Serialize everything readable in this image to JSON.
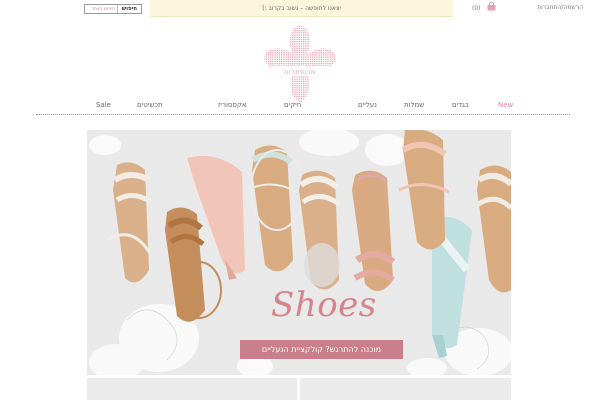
{
  "topbar": {
    "account_links": "הרשמה/התחברות",
    "cart_count": "(0)",
    "promo_text": "יצאנו לחופשה – נשוב בקרוב :)",
    "search_button": "חיפוש",
    "search_placeholder": "חיפוש באתר"
  },
  "logo": {
    "text": "מכופתרות",
    "color": "#e8a3b4"
  },
  "nav": {
    "items": [
      {
        "label": "New"
      },
      {
        "label": "בגדים"
      },
      {
        "label": "שמלות"
      },
      {
        "label": "נעליים"
      },
      {
        "label": "חיקים"
      },
      {
        "label": "אקססוריז"
      },
      {
        "label": "תכשיטים"
      },
      {
        "label": "Sale"
      }
    ],
    "active_color": "#e4839f"
  },
  "hero": {
    "title": "Shoes",
    "badge": "מוכנה להתרגש? קולקציית הנעליים",
    "title_color": "#d4848c",
    "badge_color": "#c97f8b"
  },
  "icons": {
    "cart": "shopping-bag-icon",
    "logo": "flower-logo-icon"
  }
}
